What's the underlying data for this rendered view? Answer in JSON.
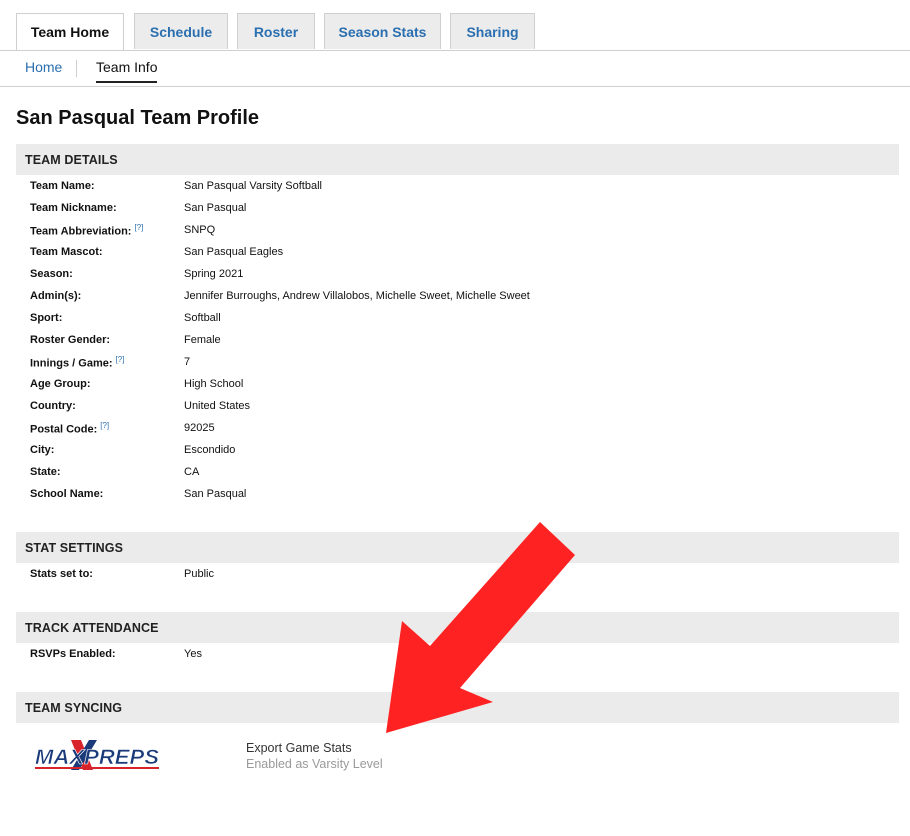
{
  "tabs": [
    {
      "label": "Team Home"
    },
    {
      "label": "Schedule"
    },
    {
      "label": "Roster"
    },
    {
      "label": "Season Stats"
    },
    {
      "label": "Sharing"
    }
  ],
  "subnav": {
    "home": "Home",
    "team_info": "Team Info"
  },
  "page_title": "San Pasqual Team Profile",
  "team_details": {
    "heading": "TEAM DETAILS",
    "help_glyph": "[?]",
    "rows": [
      {
        "label": "Team Name:",
        "value": "San Pasqual Varsity Softball"
      },
      {
        "label": "Team Nickname:",
        "value": "San Pasqual"
      },
      {
        "label": "Team Abbreviation:",
        "value": "SNPQ"
      },
      {
        "label": "Team Mascot:",
        "value": "San Pasqual Eagles"
      },
      {
        "label": "Season:",
        "value": "Spring 2021"
      },
      {
        "label": "Admin(s):",
        "value": "Jennifer Burroughs, Andrew Villalobos, Michelle Sweet, Michelle Sweet"
      },
      {
        "label": "Sport:",
        "value": "Softball"
      },
      {
        "label": "Roster Gender:",
        "value": "Female"
      },
      {
        "label": "Innings / Game:",
        "value": "7"
      },
      {
        "label": "Age Group:",
        "value": "High School"
      },
      {
        "label": "Country:",
        "value": "United States"
      },
      {
        "label": "Postal Code:",
        "value": "92025"
      },
      {
        "label": "City:",
        "value": "Escondido"
      },
      {
        "label": "State:",
        "value": "CA"
      },
      {
        "label": "School Name:",
        "value": "San Pasqual"
      }
    ]
  },
  "stat_settings": {
    "heading": "STAT SETTINGS",
    "rows": [
      {
        "label": "Stats set to:",
        "value": "Public"
      }
    ]
  },
  "track_attendance": {
    "heading": "TRACK ATTENDANCE",
    "rows": [
      {
        "label": "RSVPs Enabled:",
        "value": "Yes"
      }
    ]
  },
  "team_syncing": {
    "heading": "TEAM SYNCING",
    "logo_text": "MAXPREPS",
    "sync_title": "Export Game Stats",
    "sync_status": "Enabled as Varsity Level"
  },
  "colors": {
    "link_blue": "#2a6fb0",
    "section_bg": "#ebebeb",
    "arrow_red": "#ff2222",
    "logo_blue": "#1a3a7a",
    "logo_red": "#d8232a"
  },
  "icons": {
    "annotation": "red-arrow-icon",
    "help": "help-icon"
  }
}
